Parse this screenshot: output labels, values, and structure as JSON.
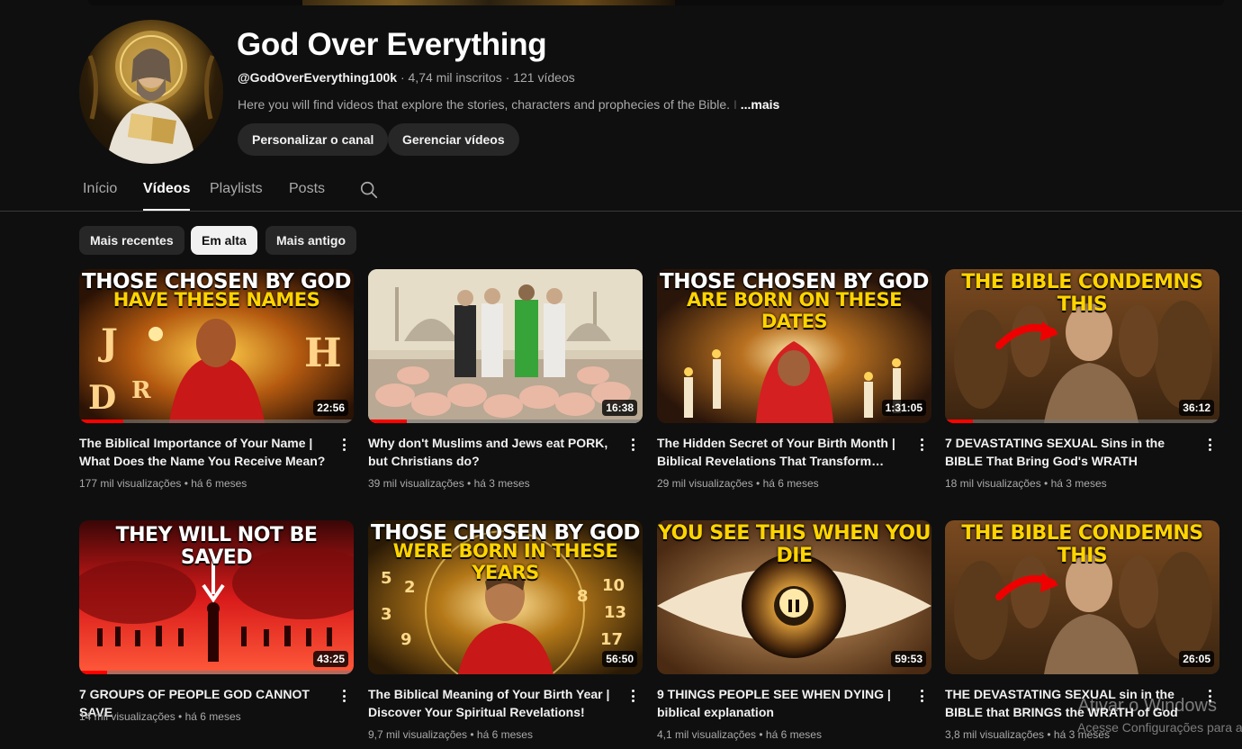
{
  "channel": {
    "name": "God Over Everything",
    "handle": "@GodOverEverything100k",
    "subscribers": "4,74 mil inscritos",
    "video_count": "121 vídeos",
    "description": "Here you will find videos that explore the stories, characters and prophecies of the Bible.",
    "description_tail": "  I",
    "more_label": "...mais",
    "customize_label": "Personalizar o canal",
    "manage_label": "Gerenciar vídeos"
  },
  "tabs": [
    {
      "label": "Início"
    },
    {
      "label": "Vídeos"
    },
    {
      "label": "Playlists"
    },
    {
      "label": "Posts"
    }
  ],
  "chips": [
    {
      "label": "Mais recentes"
    },
    {
      "label": "Em alta"
    },
    {
      "label": "Mais antigo"
    }
  ],
  "sep": "·",
  "videos": [
    {
      "title": "The Biblical Importance of Your Name | What Does the Name You Receive Mean?",
      "meta": "177 mil visualizações • há 6 meses",
      "duration": "22:56",
      "progress": 0.16,
      "thumb_line1": "THOSE CHOSEN BY GOD",
      "thumb_line2": "HAVE THESE NAMES"
    },
    {
      "title": "Why don't Muslims and Jews eat PORK, but Christians do?",
      "meta": "39 mil visualizações • há 3 meses",
      "duration": "16:38",
      "progress": 0.14
    },
    {
      "title": "The Hidden Secret of Your Birth Month | Biblical Revelations That Transform Your…",
      "meta": "29 mil visualizações • há 6 meses",
      "duration": "1:31:05",
      "progress": 0.0,
      "thumb_line1": "THOSE CHOSEN BY GOD",
      "thumb_line2": "ARE BORN ON THESE DATES"
    },
    {
      "title": "7 DEVASTATING SEXUAL Sins in the BIBLE That Bring God's WRATH",
      "meta": "18 mil visualizações • há 3 meses",
      "duration": "36:12",
      "progress": 0.1,
      "thumb_line1": "THE BIBLE CONDEMNS THIS"
    },
    {
      "title": "7 GROUPS OF PEOPLE GOD CANNOT SAVE",
      "meta": "14 mil visualizações • há 6 meses",
      "duration": "43:25",
      "progress": 0.1,
      "thumb_line1": "THEY WILL NOT BE SAVED"
    },
    {
      "title": "The Biblical Meaning of Your Birth Year | Discover Your Spiritual Revelations!",
      "meta": "9,7 mil visualizações • há 6 meses",
      "duration": "56:50",
      "progress": 0.0,
      "thumb_line1": "THOSE CHOSEN BY GOD",
      "thumb_line2": "WERE BORN IN THESE YEARS"
    },
    {
      "title": "9 THINGS PEOPLE SEE WHEN DYING | biblical explanation",
      "meta": "4,1 mil visualizações • há 6 meses",
      "duration": "59:53",
      "progress": 0.0,
      "thumb_line1": "YOU SEE THIS WHEN YOU DIE"
    },
    {
      "title": "THE DEVASTATING SEXUAL sin in the BIBLE that BRINGS the WRATH of God",
      "meta": "3,8 mil visualizações • há 3 meses",
      "duration": "26:05",
      "progress": 0.0,
      "thumb_line1": "THE BIBLE CONDEMNS THIS"
    }
  ],
  "watermark": {
    "line1": "Ativar o Windows",
    "line2": "Acesse Configurações para a"
  },
  "colors": {
    "background": "#0f0f0f",
    "chip_bg": "#272727",
    "progress_red": "#ff0000",
    "thumb_yellow": "#ffd400"
  }
}
